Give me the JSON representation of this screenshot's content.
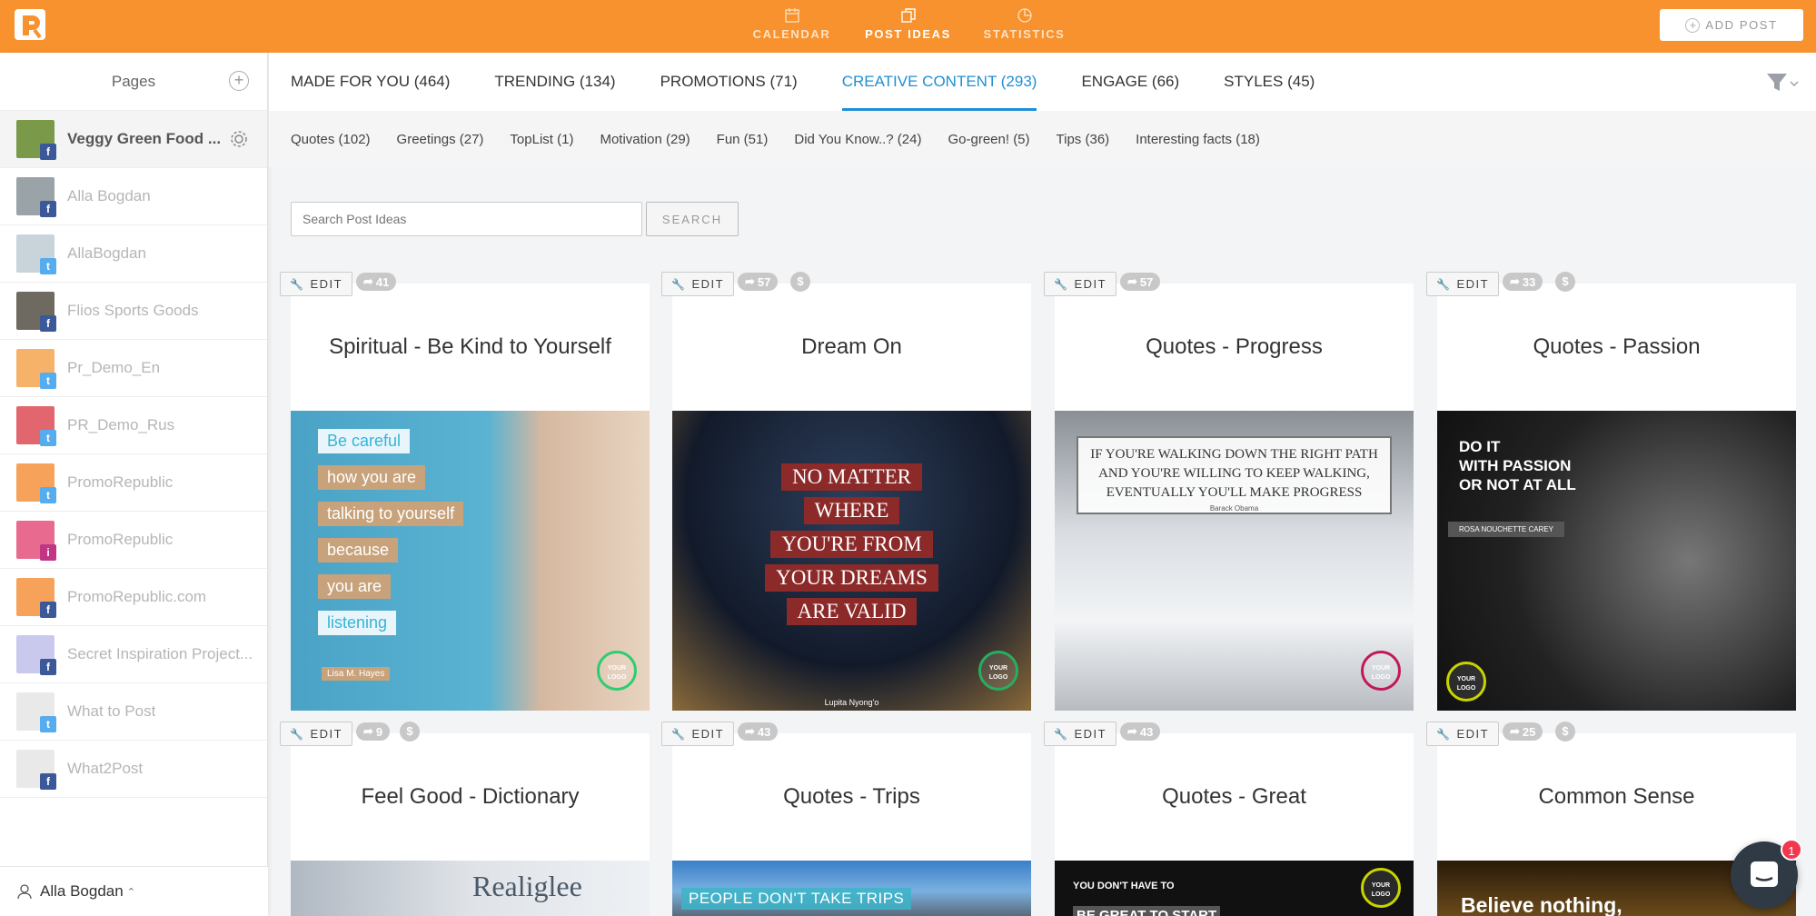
{
  "nav": {
    "items": [
      {
        "label": "CALENDAR",
        "icon": "calendar-icon"
      },
      {
        "label": "POST IDEAS",
        "icon": "copy-icon"
      },
      {
        "label": "STATISTICS",
        "icon": "pie-chart-icon"
      }
    ],
    "add_post": "ADD POST"
  },
  "colors": {
    "brand": "#f7922e",
    "active_tab": "#1f8fd6"
  },
  "sidebar": {
    "title": "Pages",
    "pages": [
      {
        "name": "Veggy Green Food ...",
        "network": "f",
        "active": true
      },
      {
        "name": "Alla Bogdan",
        "network": "f"
      },
      {
        "name": "AllaBogdan",
        "network": "t"
      },
      {
        "name": "Flios Sports Goods",
        "network": "f"
      },
      {
        "name": "Pr_Demo_En",
        "network": "t"
      },
      {
        "name": "PR_Demo_Rus",
        "network": "t"
      },
      {
        "name": "PromoRepublic",
        "network": "t"
      },
      {
        "name": "PromoRepublic",
        "network": "i"
      },
      {
        "name": "PromoRepublic.com",
        "network": "f"
      },
      {
        "name": "Secret Inspiration Project...",
        "network": "f"
      },
      {
        "name": "What to Post",
        "network": "t"
      },
      {
        "name": "What2Post",
        "network": "f"
      }
    ],
    "user": "Alla Bogdan"
  },
  "tabs": [
    {
      "label": "MADE FOR YOU (464)"
    },
    {
      "label": "TRENDING (134)"
    },
    {
      "label": "PROMOTIONS (71)"
    },
    {
      "label": "CREATIVE CONTENT (293)",
      "active": true
    },
    {
      "label": "ENGAGE (66)"
    },
    {
      "label": "STYLES (45)"
    }
  ],
  "subtabs": [
    "Quotes (102)",
    "Greetings (27)",
    "TopList (1)",
    "Motivation (29)",
    "Fun (51)",
    "Did You Know..? (24)",
    "Go-green! (5)",
    "Tips (36)",
    "Interesting facts (18)"
  ],
  "search": {
    "placeholder": "Search Post Ideas",
    "button": "SEARCH"
  },
  "edit_label": "EDIT",
  "cards": [
    {
      "title": "Spiritual - Be Kind to Yourself",
      "shares": "41",
      "paid": false,
      "image_text": [
        "Be careful",
        "how you are",
        "talking to yourself",
        "because",
        "you are",
        "listening"
      ],
      "author": "Lisa M. Hayes"
    },
    {
      "title": "Dream On",
      "shares": "57",
      "paid": true,
      "image_text": [
        "NO MATTER",
        "WHERE",
        "YOU'RE FROM",
        "YOUR DREAMS",
        "ARE VALID"
      ],
      "author": "Lupita Nyong'o"
    },
    {
      "title": "Quotes - Progress",
      "shares": "57",
      "paid": false,
      "image_text": [
        "IF YOU'RE WALKING DOWN THE RIGHT PATH",
        "AND YOU'RE WILLING TO KEEP WALKING,",
        "EVENTUALLY YOU'LL MAKE PROGRESS"
      ],
      "author": "Barack Obama"
    },
    {
      "title": "Quotes - Passion",
      "shares": "33",
      "paid": true,
      "image_text": [
        "DO IT",
        "WITH PASSION",
        "OR NOT AT ALL"
      ],
      "author": "ROSA NOUCHETTE CAREY"
    },
    {
      "title": "Feel Good - Dictionary",
      "shares": "9",
      "paid": true,
      "image_text": [
        "Realiglee"
      ]
    },
    {
      "title": "Quotes - Trips",
      "shares": "43",
      "paid": false,
      "image_text": [
        "PEOPLE DON'T TAKE TRIPS"
      ]
    },
    {
      "title": "Quotes - Great",
      "shares": "43",
      "paid": false,
      "image_text": [
        "YOU DON'T HAVE TO",
        "BE GREAT TO START"
      ]
    },
    {
      "title": "Common Sense",
      "shares": "25",
      "paid": true,
      "image_text": [
        "Believe nothing,"
      ]
    }
  ],
  "logo_badge": "YOUR LOGO",
  "dollar": "$",
  "chat_badge": "1"
}
